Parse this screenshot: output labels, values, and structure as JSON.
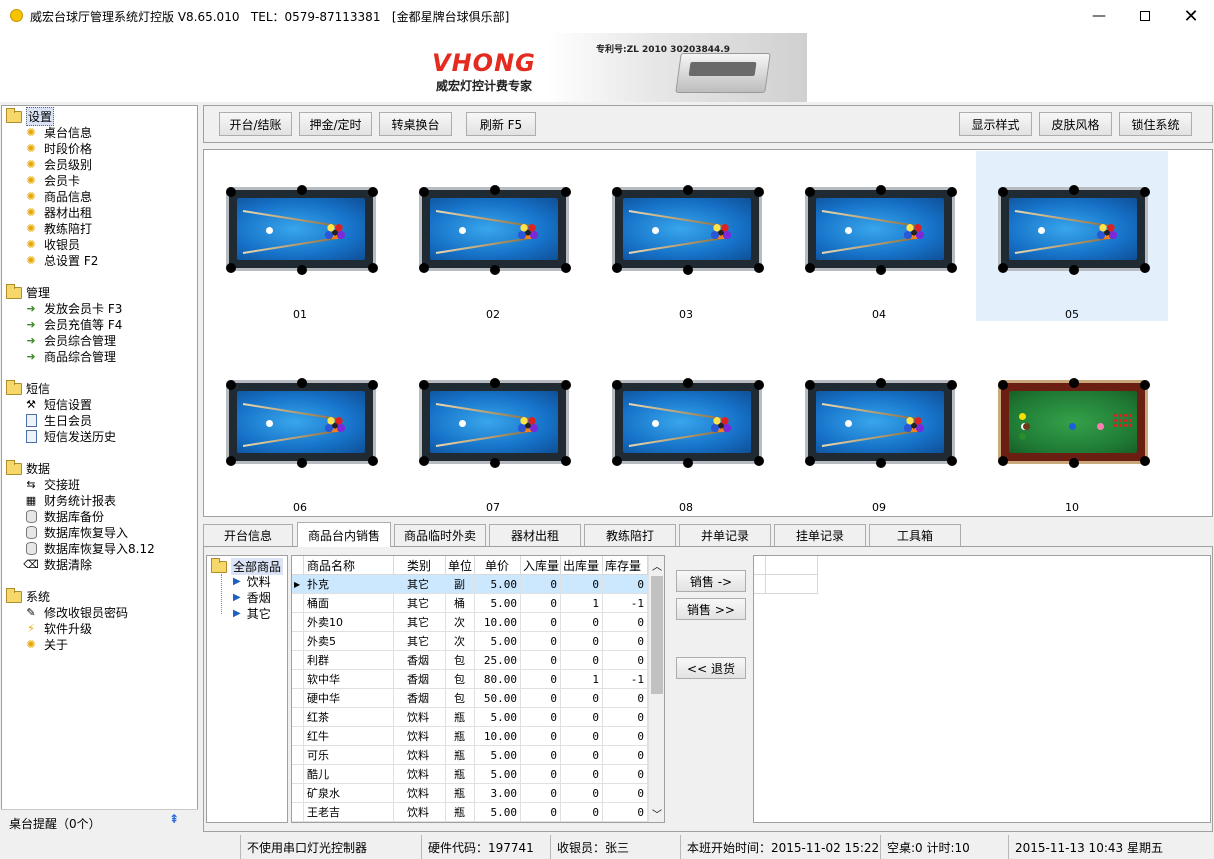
{
  "window": {
    "title": "威宏台球厅管理系统灯控版 V8.65.010   TEL：0579-87113381   [金都星牌台球俱乐部]"
  },
  "banner": {
    "brand": "VHONG",
    "tagline": "威宏灯控计费专家",
    "patent": "专利号:ZL 2010 30203844.9"
  },
  "sidebar": {
    "groups": [
      {
        "label": "设置",
        "items": [
          "桌台信息",
          "时段价格",
          "会员级别",
          "会员卡",
          "商品信息",
          "器材出租",
          "教练陪打",
          "收银员",
          "总设置 F2"
        ]
      },
      {
        "label": "管理",
        "items": [
          "发放会员卡 F3",
          "会员充值等 F4",
          "会员综合管理",
          "商品综合管理"
        ]
      },
      {
        "label": "短信",
        "items": [
          "短信设置",
          "生日会员",
          "短信发送历史"
        ]
      },
      {
        "label": "数据",
        "items": [
          "交接班",
          "财务统计报表",
          "数据库备份",
          "数据库恢复导入",
          "数据库恢复导入8.12",
          "数据清除"
        ]
      },
      {
        "label": "系统",
        "items": [
          "修改收银员密码",
          "软件升级",
          "关于"
        ]
      }
    ],
    "footer": "桌台提醒（0个）"
  },
  "toolbar": {
    "open_close": "开台/结账",
    "deposit": "押金/定时",
    "transfer": "转桌换台",
    "refresh": "刷新 F5",
    "display_style": "显示样式",
    "skin": "皮肤风格",
    "lock": "锁住系统"
  },
  "tables": [
    "01",
    "02",
    "03",
    "04",
    "05",
    "06",
    "07",
    "08",
    "09",
    "10"
  ],
  "tabs": [
    "开台信息",
    "商品台内销售",
    "商品临时外卖",
    "器材出租",
    "教练陪打",
    "并单记录",
    "挂单记录",
    "工具箱"
  ],
  "categories": {
    "root": "全部商品",
    "children": [
      "饮料",
      "香烟",
      "其它"
    ]
  },
  "grid": {
    "headers": [
      "商品名称",
      "类别",
      "单位",
      "单价",
      "入库量",
      "出库量",
      "库存量"
    ],
    "rows": [
      [
        "扑克",
        "其它",
        "副",
        "5.00",
        "0",
        "0",
        "0"
      ],
      [
        "桶面",
        "其它",
        "桶",
        "5.00",
        "0",
        "1",
        "-1"
      ],
      [
        "外卖10",
        "其它",
        "次",
        "10.00",
        "0",
        "0",
        "0"
      ],
      [
        "外卖5",
        "其它",
        "次",
        "5.00",
        "0",
        "0",
        "0"
      ],
      [
        "利群",
        "香烟",
        "包",
        "25.00",
        "0",
        "0",
        "0"
      ],
      [
        "软中华",
        "香烟",
        "包",
        "80.00",
        "0",
        "1",
        "-1"
      ],
      [
        "硬中华",
        "香烟",
        "包",
        "50.00",
        "0",
        "0",
        "0"
      ],
      [
        "红茶",
        "饮料",
        "瓶",
        "5.00",
        "0",
        "0",
        "0"
      ],
      [
        "红牛",
        "饮料",
        "瓶",
        "10.00",
        "0",
        "0",
        "0"
      ],
      [
        "可乐",
        "饮料",
        "瓶",
        "5.00",
        "0",
        "0",
        "0"
      ],
      [
        "酷儿",
        "饮料",
        "瓶",
        "5.00",
        "0",
        "0",
        "0"
      ],
      [
        "矿泉水",
        "饮料",
        "瓶",
        "3.00",
        "0",
        "0",
        "0"
      ],
      [
        "王老吉",
        "饮料",
        "瓶",
        "5.00",
        "0",
        "0",
        "0"
      ]
    ]
  },
  "sale": {
    "sell_one": "销售 ->",
    "sell_all": "销售 >>",
    "return": "<< 退货"
  },
  "status": {
    "light": "不使用串口灯光控制器",
    "hwcode": "硬件代码：197741",
    "cashier": "收银员：张三",
    "shift_start": "本班开始时间：2015-11-02 15:22",
    "idle": "空桌:0 计时:10",
    "datetime": "2015-11-13 10:43 星期五"
  }
}
